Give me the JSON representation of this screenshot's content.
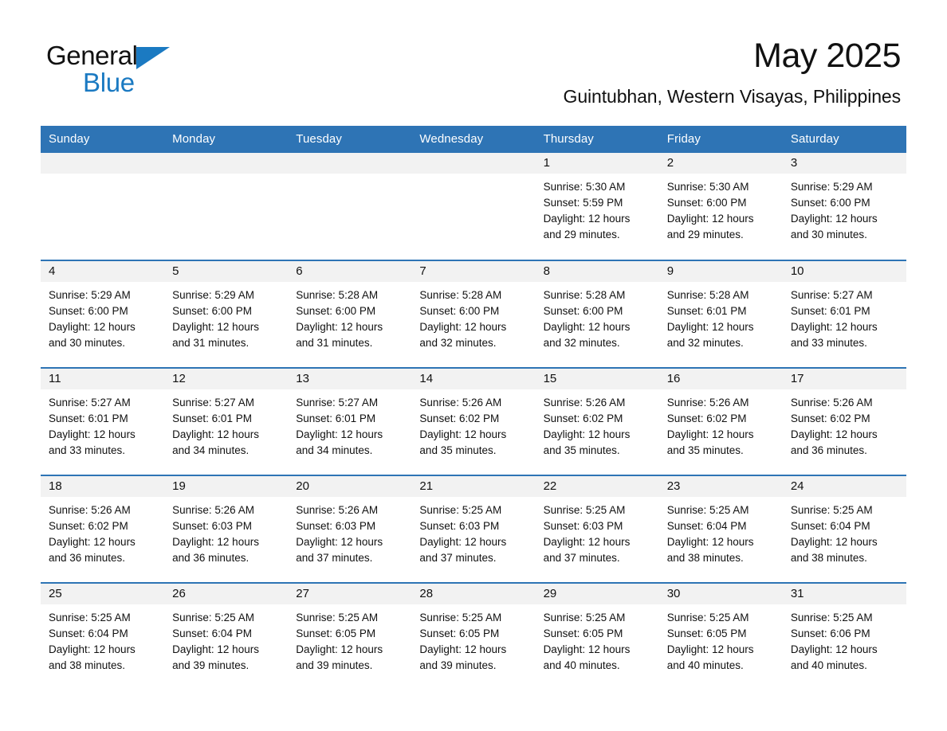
{
  "brand": {
    "name_part1": "General",
    "name_part2": "Blue",
    "accent_color": "#1B7AC2"
  },
  "header": {
    "title": "May 2025",
    "subtitle": "Guintubhan, Western Visayas, Philippines"
  },
  "theme": {
    "header_blue": "#2E74B5",
    "daynum_band": "#F2F2F2",
    "text": "#111111"
  },
  "weekday_headers": [
    "Sunday",
    "Monday",
    "Tuesday",
    "Wednesday",
    "Thursday",
    "Friday",
    "Saturday"
  ],
  "weeks": [
    [
      {
        "day": "",
        "empty": true
      },
      {
        "day": "",
        "empty": true
      },
      {
        "day": "",
        "empty": true
      },
      {
        "day": "",
        "empty": true
      },
      {
        "day": "1",
        "sunrise": "Sunrise: 5:30 AM",
        "sunset": "Sunset: 5:59 PM",
        "daylight1": "Daylight: 12 hours",
        "daylight2": "and 29 minutes."
      },
      {
        "day": "2",
        "sunrise": "Sunrise: 5:30 AM",
        "sunset": "Sunset: 6:00 PM",
        "daylight1": "Daylight: 12 hours",
        "daylight2": "and 29 minutes."
      },
      {
        "day": "3",
        "sunrise": "Sunrise: 5:29 AM",
        "sunset": "Sunset: 6:00 PM",
        "daylight1": "Daylight: 12 hours",
        "daylight2": "and 30 minutes."
      }
    ],
    [
      {
        "day": "4",
        "sunrise": "Sunrise: 5:29 AM",
        "sunset": "Sunset: 6:00 PM",
        "daylight1": "Daylight: 12 hours",
        "daylight2": "and 30 minutes."
      },
      {
        "day": "5",
        "sunrise": "Sunrise: 5:29 AM",
        "sunset": "Sunset: 6:00 PM",
        "daylight1": "Daylight: 12 hours",
        "daylight2": "and 31 minutes."
      },
      {
        "day": "6",
        "sunrise": "Sunrise: 5:28 AM",
        "sunset": "Sunset: 6:00 PM",
        "daylight1": "Daylight: 12 hours",
        "daylight2": "and 31 minutes."
      },
      {
        "day": "7",
        "sunrise": "Sunrise: 5:28 AM",
        "sunset": "Sunset: 6:00 PM",
        "daylight1": "Daylight: 12 hours",
        "daylight2": "and 32 minutes."
      },
      {
        "day": "8",
        "sunrise": "Sunrise: 5:28 AM",
        "sunset": "Sunset: 6:00 PM",
        "daylight1": "Daylight: 12 hours",
        "daylight2": "and 32 minutes."
      },
      {
        "day": "9",
        "sunrise": "Sunrise: 5:28 AM",
        "sunset": "Sunset: 6:01 PM",
        "daylight1": "Daylight: 12 hours",
        "daylight2": "and 32 minutes."
      },
      {
        "day": "10",
        "sunrise": "Sunrise: 5:27 AM",
        "sunset": "Sunset: 6:01 PM",
        "daylight1": "Daylight: 12 hours",
        "daylight2": "and 33 minutes."
      }
    ],
    [
      {
        "day": "11",
        "sunrise": "Sunrise: 5:27 AM",
        "sunset": "Sunset: 6:01 PM",
        "daylight1": "Daylight: 12 hours",
        "daylight2": "and 33 minutes."
      },
      {
        "day": "12",
        "sunrise": "Sunrise: 5:27 AM",
        "sunset": "Sunset: 6:01 PM",
        "daylight1": "Daylight: 12 hours",
        "daylight2": "and 34 minutes."
      },
      {
        "day": "13",
        "sunrise": "Sunrise: 5:27 AM",
        "sunset": "Sunset: 6:01 PM",
        "daylight1": "Daylight: 12 hours",
        "daylight2": "and 34 minutes."
      },
      {
        "day": "14",
        "sunrise": "Sunrise: 5:26 AM",
        "sunset": "Sunset: 6:02 PM",
        "daylight1": "Daylight: 12 hours",
        "daylight2": "and 35 minutes."
      },
      {
        "day": "15",
        "sunrise": "Sunrise: 5:26 AM",
        "sunset": "Sunset: 6:02 PM",
        "daylight1": "Daylight: 12 hours",
        "daylight2": "and 35 minutes."
      },
      {
        "day": "16",
        "sunrise": "Sunrise: 5:26 AM",
        "sunset": "Sunset: 6:02 PM",
        "daylight1": "Daylight: 12 hours",
        "daylight2": "and 35 minutes."
      },
      {
        "day": "17",
        "sunrise": "Sunrise: 5:26 AM",
        "sunset": "Sunset: 6:02 PM",
        "daylight1": "Daylight: 12 hours",
        "daylight2": "and 36 minutes."
      }
    ],
    [
      {
        "day": "18",
        "sunrise": "Sunrise: 5:26 AM",
        "sunset": "Sunset: 6:02 PM",
        "daylight1": "Daylight: 12 hours",
        "daylight2": "and 36 minutes."
      },
      {
        "day": "19",
        "sunrise": "Sunrise: 5:26 AM",
        "sunset": "Sunset: 6:03 PM",
        "daylight1": "Daylight: 12 hours",
        "daylight2": "and 36 minutes."
      },
      {
        "day": "20",
        "sunrise": "Sunrise: 5:26 AM",
        "sunset": "Sunset: 6:03 PM",
        "daylight1": "Daylight: 12 hours",
        "daylight2": "and 37 minutes."
      },
      {
        "day": "21",
        "sunrise": "Sunrise: 5:25 AM",
        "sunset": "Sunset: 6:03 PM",
        "daylight1": "Daylight: 12 hours",
        "daylight2": "and 37 minutes."
      },
      {
        "day": "22",
        "sunrise": "Sunrise: 5:25 AM",
        "sunset": "Sunset: 6:03 PM",
        "daylight1": "Daylight: 12 hours",
        "daylight2": "and 37 minutes."
      },
      {
        "day": "23",
        "sunrise": "Sunrise: 5:25 AM",
        "sunset": "Sunset: 6:04 PM",
        "daylight1": "Daylight: 12 hours",
        "daylight2": "and 38 minutes."
      },
      {
        "day": "24",
        "sunrise": "Sunrise: 5:25 AM",
        "sunset": "Sunset: 6:04 PM",
        "daylight1": "Daylight: 12 hours",
        "daylight2": "and 38 minutes."
      }
    ],
    [
      {
        "day": "25",
        "sunrise": "Sunrise: 5:25 AM",
        "sunset": "Sunset: 6:04 PM",
        "daylight1": "Daylight: 12 hours",
        "daylight2": "and 38 minutes."
      },
      {
        "day": "26",
        "sunrise": "Sunrise: 5:25 AM",
        "sunset": "Sunset: 6:04 PM",
        "daylight1": "Daylight: 12 hours",
        "daylight2": "and 39 minutes."
      },
      {
        "day": "27",
        "sunrise": "Sunrise: 5:25 AM",
        "sunset": "Sunset: 6:05 PM",
        "daylight1": "Daylight: 12 hours",
        "daylight2": "and 39 minutes."
      },
      {
        "day": "28",
        "sunrise": "Sunrise: 5:25 AM",
        "sunset": "Sunset: 6:05 PM",
        "daylight1": "Daylight: 12 hours",
        "daylight2": "and 39 minutes."
      },
      {
        "day": "29",
        "sunrise": "Sunrise: 5:25 AM",
        "sunset": "Sunset: 6:05 PM",
        "daylight1": "Daylight: 12 hours",
        "daylight2": "and 40 minutes."
      },
      {
        "day": "30",
        "sunrise": "Sunrise: 5:25 AM",
        "sunset": "Sunset: 6:05 PM",
        "daylight1": "Daylight: 12 hours",
        "daylight2": "and 40 minutes."
      },
      {
        "day": "31",
        "sunrise": "Sunrise: 5:25 AM",
        "sunset": "Sunset: 6:06 PM",
        "daylight1": "Daylight: 12 hours",
        "daylight2": "and 40 minutes."
      }
    ]
  ]
}
